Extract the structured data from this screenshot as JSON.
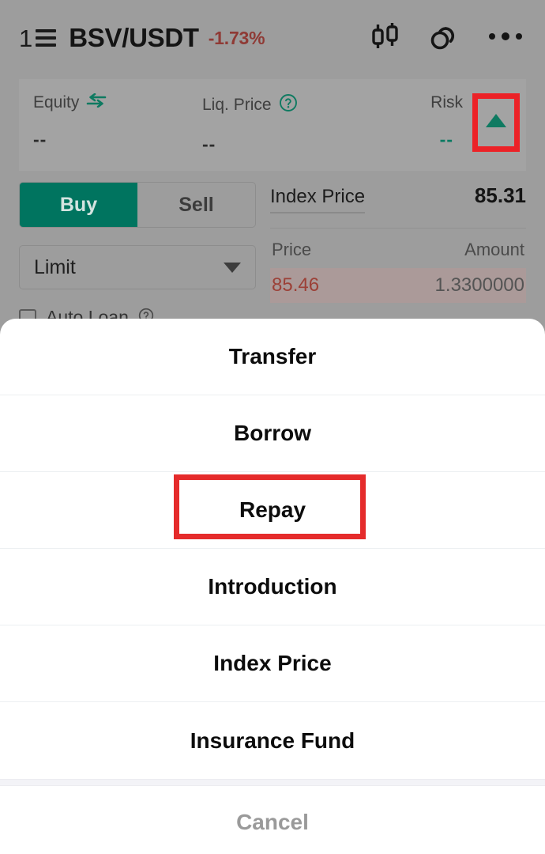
{
  "header": {
    "list_icon_digit": "1",
    "list_icon_name": "list-order-icon",
    "pair": "BSV/USDT",
    "change": "-1.73%",
    "change_color": "#8f3a35",
    "actions": [
      {
        "name": "candlestick-chart-icon"
      },
      {
        "name": "link-chain-icon"
      },
      {
        "name": "more-options-icon"
      }
    ]
  },
  "stats": {
    "equity": {
      "label": "Equity",
      "value": "--",
      "icon": "swap-arrows-icon"
    },
    "liq_price": {
      "label": "Liq. Price",
      "value": "--",
      "icon": "help-circle-icon"
    },
    "risk": {
      "label": "Risk",
      "value": "--",
      "icon": "triangle-up-icon",
      "icon_color": "#0f7a61"
    }
  },
  "order_form": {
    "buy_label": "Buy",
    "sell_label": "Sell",
    "active_side": "Buy",
    "buy_color": "#00745f",
    "order_type": "Limit",
    "auto_loan_label": "Auto Loan",
    "auto_loan_checked": false
  },
  "orderbook": {
    "index_price_label": "Index Price",
    "index_price_value": "85.31",
    "col_price": "Price",
    "col_amount": "Amount",
    "rows": [
      {
        "price": "85.46",
        "amount": "1.3300000",
        "side": "ask"
      }
    ]
  },
  "action_sheet": {
    "items": [
      {
        "label": "Transfer",
        "name": "sheet-item-transfer"
      },
      {
        "label": "Borrow",
        "name": "sheet-item-borrow"
      },
      {
        "label": "Repay",
        "name": "sheet-item-repay",
        "highlighted": true
      },
      {
        "label": "Introduction",
        "name": "sheet-item-introduction"
      },
      {
        "label": "Index Price",
        "name": "sheet-item-index-price"
      },
      {
        "label": "Insurance Fund",
        "name": "sheet-item-insurance-fund"
      }
    ],
    "cancel_label": "Cancel",
    "highlight_color": "#e52b2b"
  }
}
